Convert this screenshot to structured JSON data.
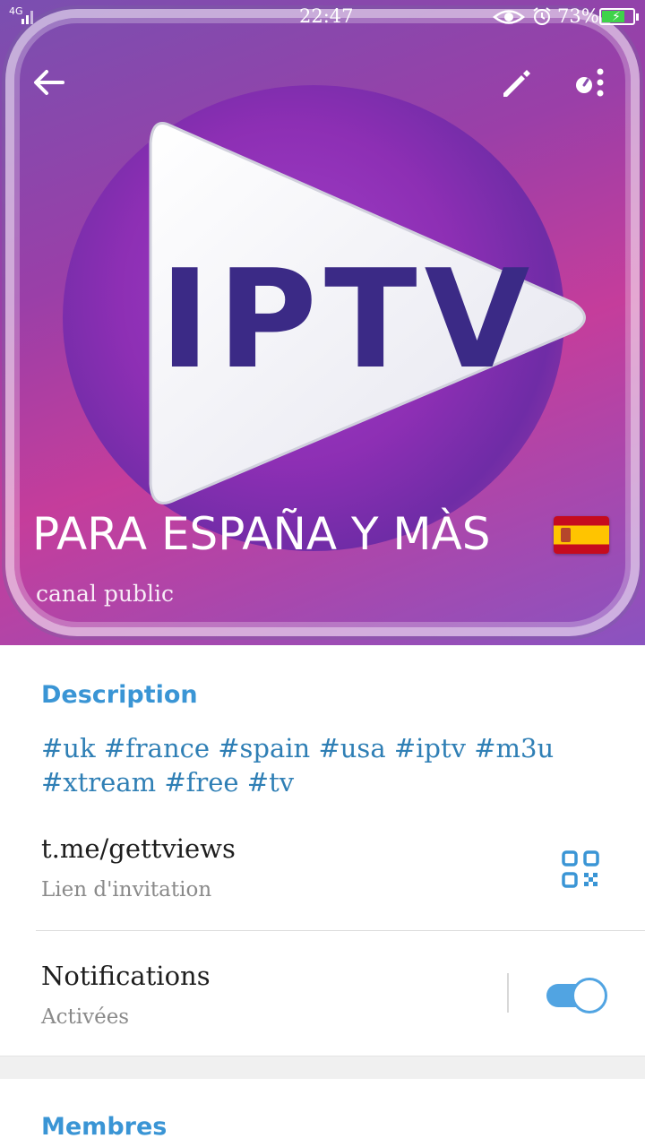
{
  "status_bar": {
    "network": "4G",
    "time": "22:47",
    "battery_percent": "73%",
    "battery_level": 0.73,
    "icons": [
      "signal-icon",
      "eye-icon",
      "alarm-icon",
      "battery-icon"
    ]
  },
  "header": {
    "image_text": "IPTV",
    "image_caption": "PARA ESPAÑA Y MÀS",
    "channel_type": "canal public",
    "actions": [
      "back-arrow-icon",
      "edit-pencil-icon",
      "more-options-icon"
    ]
  },
  "description": {
    "title": "Description",
    "text": "#uk #france #spain #usa #iptv #m3u #xtream #free #tv"
  },
  "invite_link": {
    "value": "t.me/gettviews",
    "label": "Lien d'invitation",
    "icon": "qr-code-icon"
  },
  "notifications": {
    "title": "Notifications",
    "status": "Activées",
    "enabled": true
  },
  "members": {
    "title": "Membres"
  },
  "colors": {
    "accent": "#3a95d5",
    "hashtag": "#2f7fb5",
    "toggle_on": "#51a4e2",
    "muted_text": "#8a8a8a",
    "header_purple": "#7a4fb0",
    "logo_text": "#3b2a86"
  }
}
